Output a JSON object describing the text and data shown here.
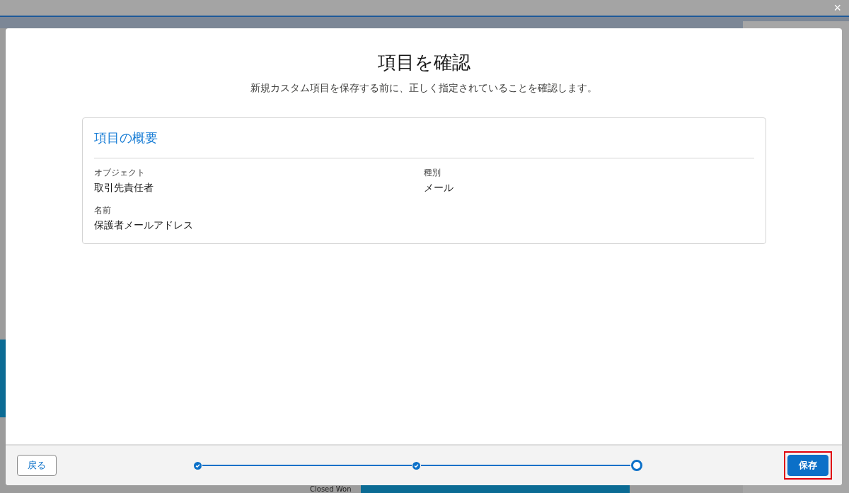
{
  "background": {
    "status_label": "Closed Won"
  },
  "modal": {
    "close": "×",
    "title": "項目を確認",
    "subtitle": "新規カスタム項目を保存する前に、正しく指定されていることを確認します。",
    "summary": {
      "heading": "項目の概要",
      "fields": [
        {
          "label": "オブジェクト",
          "value": "取引先責任者"
        },
        {
          "label": "種別",
          "value": "メール"
        },
        {
          "label": "名前",
          "value": "保護者メールアドレス"
        }
      ]
    },
    "footer": {
      "back_button": "戻る",
      "save_button": "保存",
      "save_highlighted": true,
      "steps": [
        {
          "kind": "completed"
        },
        {
          "kind": "completed"
        },
        {
          "kind": "current"
        }
      ]
    }
  }
}
